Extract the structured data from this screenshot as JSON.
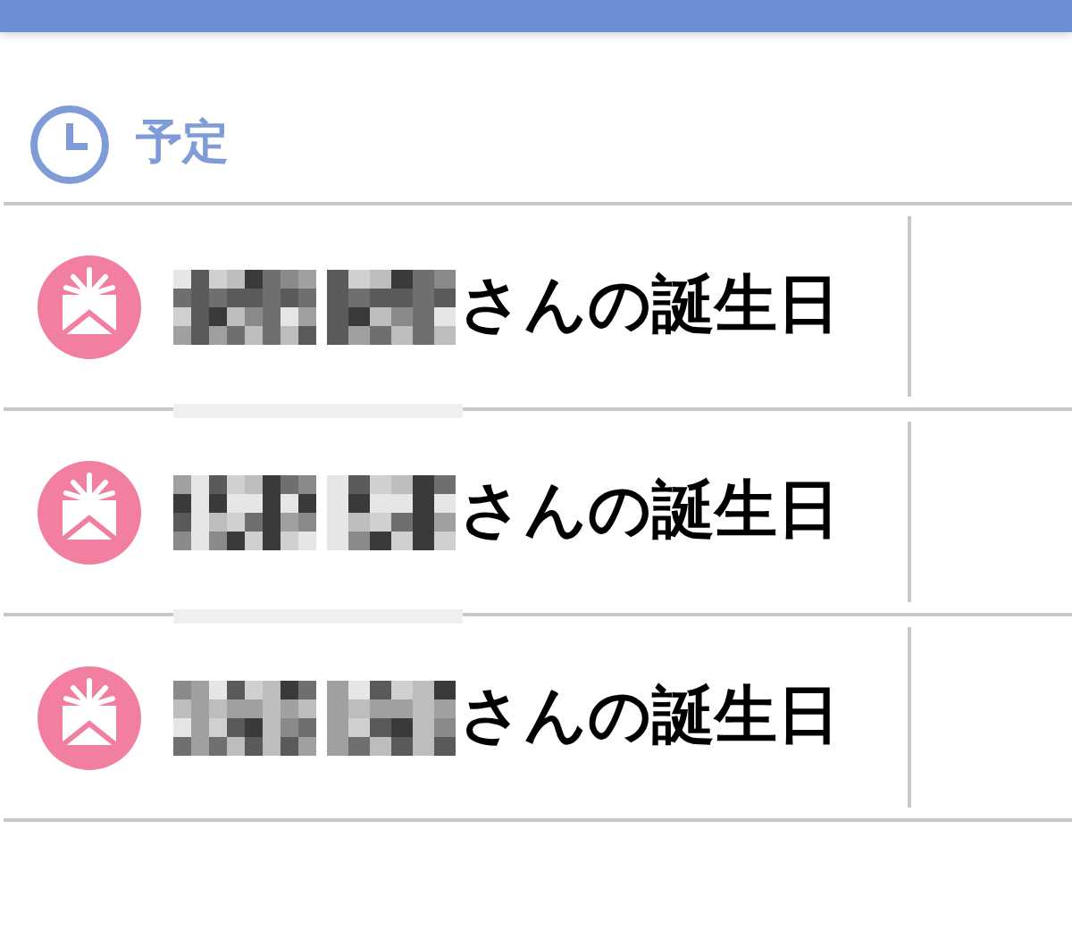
{
  "section": {
    "title": "予定"
  },
  "events": [
    {
      "name_redacted": true,
      "suffix": "さんの誕生日"
    },
    {
      "name_redacted": true,
      "suffix": "さんの誕生日"
    },
    {
      "name_redacted": true,
      "suffix": "さんの誕生日"
    }
  ]
}
